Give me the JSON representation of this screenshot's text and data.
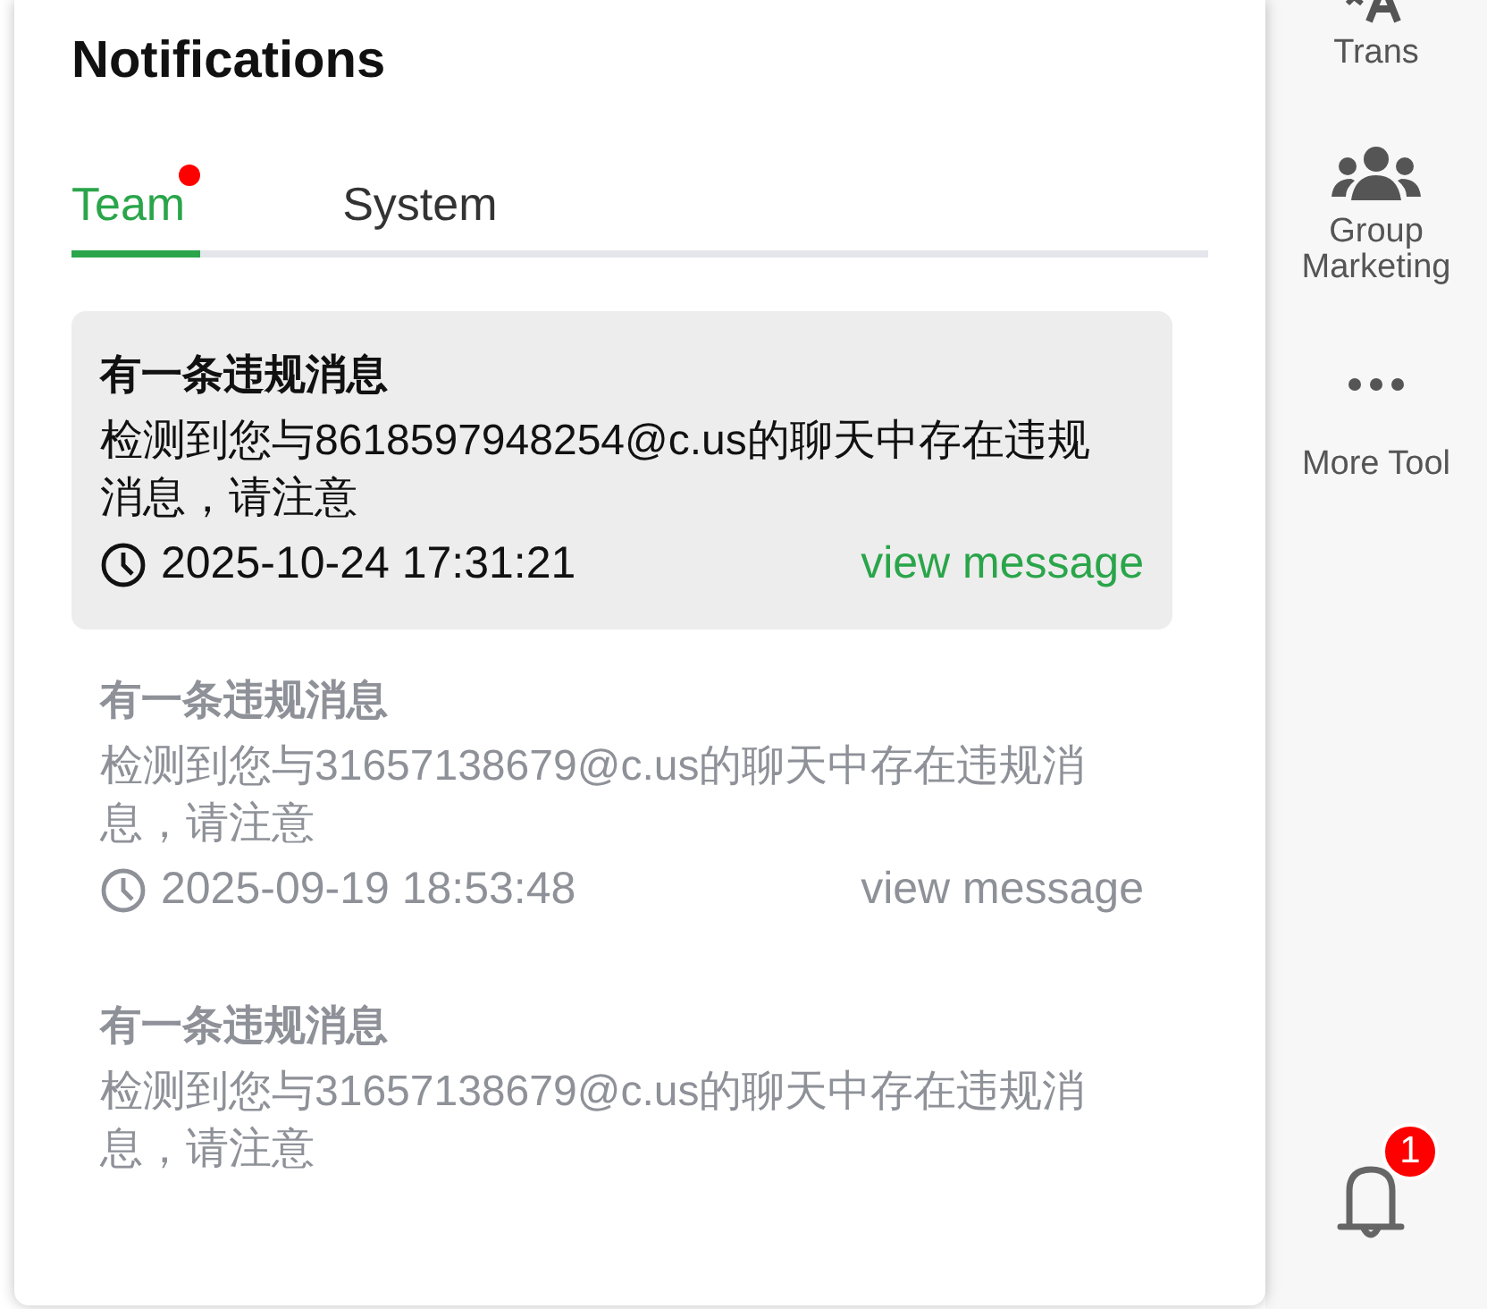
{
  "panel": {
    "title": "Notifications",
    "tabs": [
      {
        "label": "Team",
        "selected": true,
        "unread_dot": true
      },
      {
        "label": "System",
        "selected": false,
        "unread_dot": false
      }
    ],
    "notifications": [
      {
        "title": "有一条违规消息",
        "body": "检测到您与8618597948254@c.us的聊天中存在违规消息，请注意",
        "time": "2025-10-24 17:31:21",
        "action": "view message",
        "read": false
      },
      {
        "title": "有一条违规消息",
        "body": "检测到您与31657138679@c.us的聊天中存在违规消息，请注意",
        "time": "2025-09-19 18:53:48",
        "action": "view message",
        "read": true
      },
      {
        "title": "有一条违规消息",
        "body": "检测到您与31657138679@c.us的聊天中存在违规消息，请注意",
        "read": true
      }
    ]
  },
  "sidebar": {
    "items": [
      {
        "kind": "translate",
        "label": "Trans"
      },
      {
        "kind": "group",
        "label": "Group Marketing"
      },
      {
        "kind": "more",
        "label": "More Tool"
      }
    ],
    "bell": {
      "badge": "1"
    }
  }
}
